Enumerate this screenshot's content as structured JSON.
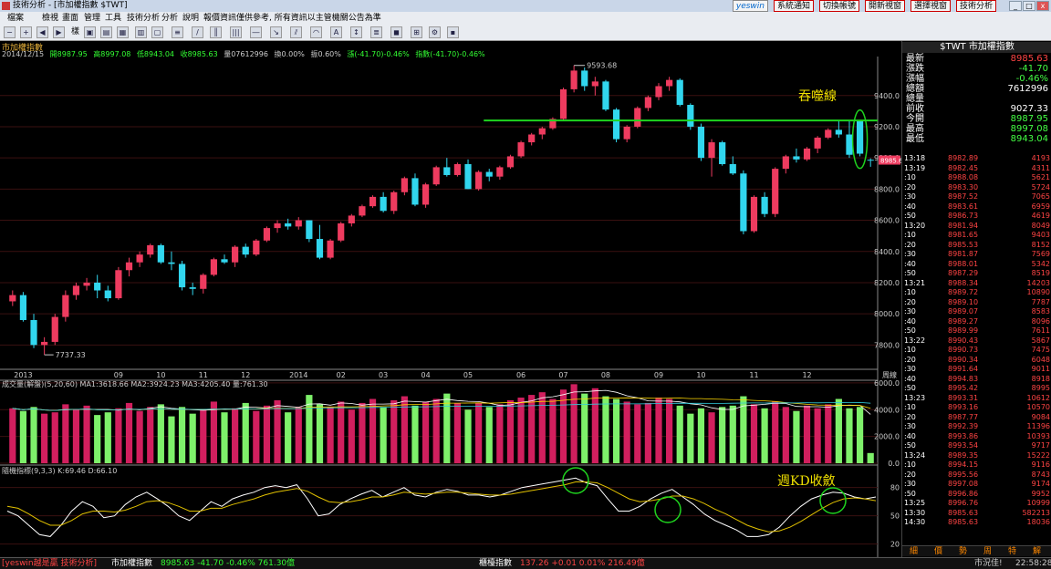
{
  "window": {
    "title": "技術分析 - [市加權指數 $TWT]",
    "min": "_",
    "max": "□",
    "close": "x"
  },
  "menu": [
    "檔案",
    "檢視",
    "畫面",
    "管理",
    "工具",
    "技術分析",
    "分析",
    "說明",
    "報價資訊僅供參考, 所有資訊以主管機關公告為準"
  ],
  "top_buttons": [
    "系統通知",
    "切換帳號",
    "開新視窗",
    "選擇視窗",
    "技術分析"
  ],
  "top_logo": "yeswin",
  "toolbar": {
    "template_label": "樣"
  },
  "chart": {
    "caption": "市加權指數",
    "info": {
      "date": "2014/12/15",
      "open": "開8987.95",
      "high": "高8997.08",
      "low": "低8943.04",
      "close": "收8985.63",
      "vol": "量07612996",
      "turnover": "換0.00%",
      "amp": "振0.60%",
      "chg": "漲(-41.70)-0.46%",
      "idx": "指數(-41.70)-0.46%"
    },
    "y_ticks": [
      "9400.0",
      "9200.0",
      "9000.0",
      "8800.0",
      "8600.0",
      "8400.0",
      "8200.0",
      "8000.0",
      "7800.0"
    ],
    "x_labels": [
      "2013",
      "09",
      "10",
      "11",
      "12",
      "2014",
      "02",
      "03",
      "04",
      "05",
      "06",
      "07",
      "08",
      "09",
      "10",
      "11",
      "12"
    ],
    "period_label": "周線",
    "high_label": "9593.68",
    "low_label": "7737.33",
    "last_price_tag": "8985.63",
    "annotation_line": "吞噬線",
    "annotation_kd": "週KD收斂",
    "colors": {
      "up": "#ee3b5f",
      "down": "#31d6ee",
      "line": "#1fd41f",
      "circle": "#1fd41f",
      "annot": "#f0e000"
    }
  },
  "volume": {
    "header": "成交量(解盤)(5,20,60) MA1:3618.66 MA2:3924.23 MA3:4205.40 量:761.30",
    "y_ticks": [
      "6000.0",
      "4000.0",
      "2000.0",
      "0.0"
    ]
  },
  "kd": {
    "header": "隨機指標(9,3,3) K:69.46 D:66.10",
    "y_ticks": [
      "80",
      "50",
      "20"
    ]
  },
  "chart_data": {
    "type": "candlestick",
    "period": "weekly",
    "ohlc": [
      [
        8080,
        8150,
        8050,
        8120
      ],
      [
        8120,
        8140,
        7950,
        7960
      ],
      [
        7960,
        8000,
        7780,
        7800
      ],
      [
        7800,
        7850,
        7737,
        7820
      ],
      [
        7820,
        8000,
        7800,
        7980
      ],
      [
        7980,
        8150,
        7950,
        8120
      ],
      [
        8120,
        8200,
        8090,
        8180
      ],
      [
        8180,
        8230,
        8150,
        8200
      ],
      [
        8200,
        8250,
        8100,
        8150
      ],
      [
        8150,
        8180,
        8080,
        8100
      ],
      [
        8100,
        8300,
        8090,
        8280
      ],
      [
        8280,
        8360,
        8240,
        8330
      ],
      [
        8330,
        8400,
        8300,
        8380
      ],
      [
        8380,
        8450,
        8360,
        8440
      ],
      [
        8440,
        8450,
        8320,
        8330
      ],
      [
        8330,
        8400,
        8280,
        8320
      ],
      [
        8320,
        8340,
        8150,
        8170
      ],
      [
        8170,
        8200,
        8120,
        8160
      ],
      [
        8160,
        8260,
        8130,
        8250
      ],
      [
        8250,
        8360,
        8240,
        8350
      ],
      [
        8350,
        8380,
        8320,
        8330
      ],
      [
        8330,
        8440,
        8300,
        8430
      ],
      [
        8430,
        8450,
        8360,
        8380
      ],
      [
        8380,
        8480,
        8370,
        8470
      ],
      [
        8470,
        8560,
        8460,
        8550
      ],
      [
        8550,
        8600,
        8520,
        8580
      ],
      [
        8580,
        8610,
        8540,
        8560
      ],
      [
        8560,
        8620,
        8540,
        8600
      ],
      [
        8600,
        8600,
        8460,
        8480
      ],
      [
        8480,
        8570,
        8350,
        8360
      ],
      [
        8360,
        8480,
        8350,
        8470
      ],
      [
        8470,
        8590,
        8460,
        8580
      ],
      [
        8580,
        8640,
        8560,
        8630
      ],
      [
        8630,
        8700,
        8620,
        8690
      ],
      [
        8690,
        8760,
        8680,
        8750
      ],
      [
        8750,
        8780,
        8650,
        8660
      ],
      [
        8660,
        8790,
        8640,
        8780
      ],
      [
        8780,
        8880,
        8760,
        8870
      ],
      [
        8870,
        8900,
        8690,
        8700
      ],
      [
        8700,
        8840,
        8680,
        8830
      ],
      [
        8830,
        8950,
        8820,
        8940
      ],
      [
        8940,
        9000,
        8880,
        8890
      ],
      [
        8890,
        8970,
        8880,
        8960
      ],
      [
        8960,
        8990,
        8800,
        8800
      ],
      [
        8800,
        8920,
        8790,
        8910
      ],
      [
        8910,
        8930,
        8850,
        8880
      ],
      [
        8880,
        8950,
        8860,
        8940
      ],
      [
        8940,
        9020,
        8930,
        9010
      ],
      [
        9010,
        9110,
        9000,
        9100
      ],
      [
        9100,
        9160,
        9080,
        9150
      ],
      [
        9150,
        9200,
        9120,
        9190
      ],
      [
        9190,
        9260,
        9180,
        9250
      ],
      [
        9250,
        9450,
        9240,
        9440
      ],
      [
        9440,
        9593,
        9420,
        9560
      ],
      [
        9560,
        9580,
        9430,
        9460
      ],
      [
        9460,
        9520,
        9400,
        9490
      ],
      [
        9490,
        9500,
        9300,
        9310
      ],
      [
        9310,
        9320,
        9100,
        9120
      ],
      [
        9120,
        9210,
        9100,
        9200
      ],
      [
        9200,
        9330,
        9190,
        9320
      ],
      [
        9320,
        9400,
        9300,
        9390
      ],
      [
        9390,
        9480,
        9370,
        9460
      ],
      [
        9460,
        9520,
        9430,
        9500
      ],
      [
        9500,
        9510,
        9330,
        9340
      ],
      [
        9340,
        9350,
        9180,
        9200
      ],
      [
        9200,
        9220,
        8980,
        9000
      ],
      [
        9000,
        9120,
        8880,
        9100
      ],
      [
        9100,
        9110,
        8950,
        8960
      ],
      [
        8960,
        9010,
        8890,
        8900
      ],
      [
        8900,
        8920,
        8510,
        8530
      ],
      [
        8530,
        8760,
        8520,
        8750
      ],
      [
        8750,
        8780,
        8620,
        8640
      ],
      [
        8640,
        8940,
        8620,
        8930
      ],
      [
        8930,
        9020,
        8900,
        9010
      ],
      [
        9010,
        9060,
        8970,
        8990
      ],
      [
        8990,
        9070,
        8980,
        9060
      ],
      [
        9060,
        9140,
        9030,
        9130
      ],
      [
        9130,
        9190,
        9120,
        9180
      ],
      [
        9180,
        9240,
        9130,
        9150
      ],
      [
        9150,
        9240,
        9000,
        9020
      ],
      [
        9240,
        9240,
        9010,
        9027
      ],
      [
        8988,
        8997,
        8943,
        8986
      ]
    ],
    "volume": [
      4100,
      3900,
      4200,
      3700,
      3800,
      4400,
      4000,
      4300,
      3600,
      3800,
      4100,
      4500,
      3900,
      4200,
      4400,
      3500,
      4200,
      3700,
      4000,
      4600,
      3800,
      4100,
      4500,
      3900,
      4300,
      4700,
      3800,
      4200,
      5100,
      4400,
      4200,
      4600,
      4000,
      4500,
      4800,
      4200,
      4700,
      5000,
      4300,
      4600,
      4800,
      5200,
      4500,
      4000,
      4500,
      4200,
      4400,
      4700,
      4900,
      5100,
      5300,
      4800,
      5500,
      5900,
      5200,
      5600,
      5000,
      4800,
      4600,
      4400,
      4500,
      4900,
      4800,
      4300,
      3700,
      4100,
      3800,
      4200,
      4300,
      5000,
      4400,
      4100,
      4600,
      4200,
      3900,
      4300,
      4100,
      4400,
      4800,
      4100,
      4200,
      761
    ],
    "kd_k": [
      55,
      50,
      40,
      30,
      28,
      40,
      55,
      65,
      60,
      48,
      50,
      62,
      70,
      75,
      68,
      60,
      50,
      45,
      55,
      65,
      60,
      68,
      72,
      75,
      80,
      82,
      80,
      83,
      68,
      50,
      52,
      62,
      68,
      73,
      77,
      70,
      75,
      80,
      72,
      70,
      75,
      78,
      76,
      72,
      72,
      70,
      72,
      76,
      80,
      82,
      84,
      86,
      88,
      90,
      85,
      82,
      68,
      55,
      55,
      60,
      68,
      74,
      78,
      70,
      62,
      52,
      45,
      40,
      35,
      28,
      28,
      30,
      38,
      50,
      60,
      68,
      72,
      75,
      74,
      70,
      68,
      70
    ],
    "kd_d": [
      60,
      58,
      52,
      45,
      40,
      40,
      45,
      52,
      55,
      55,
      54,
      56,
      60,
      65,
      66,
      64,
      60,
      55,
      55,
      58,
      58,
      62,
      65,
      68,
      72,
      75,
      77,
      79,
      76,
      70,
      65,
      64,
      65,
      67,
      70,
      70,
      72,
      75,
      74,
      73,
      74,
      75,
      75,
      74,
      73,
      72,
      72,
      73,
      75,
      77,
      79,
      81,
      83,
      86,
      86,
      85,
      80,
      74,
      68,
      65,
      66,
      68,
      71,
      71,
      68,
      63,
      57,
      52,
      46,
      40,
      36,
      33,
      34,
      38,
      44,
      51,
      58,
      64,
      68,
      69,
      68,
      66
    ],
    "y_range": [
      7650,
      9650
    ],
    "volume_range": [
      0,
      6400
    ],
    "kd_range": [
      10,
      100
    ]
  },
  "right_panel": {
    "title": "$TWT 市加權指數",
    "quotes": [
      {
        "label": "最新",
        "value": "8985.63",
        "color": "#ff4444"
      },
      {
        "label": "漲跌",
        "value": "-41.70",
        "color": "#44ff44"
      },
      {
        "label": "漲幅",
        "value": "-0.46%",
        "color": "#44ff44"
      },
      {
        "label": "總額",
        "value": "7612996",
        "color": "#ffffff"
      },
      {
        "label": "總量",
        "value": "",
        "color": "#ffffff"
      },
      {
        "label": "前收",
        "value": "9027.33",
        "color": "#ffffff"
      },
      {
        "label": "今開",
        "value": "8987.95",
        "color": "#44ff44"
      },
      {
        "label": "最高",
        "value": "8997.08",
        "color": "#44ff44"
      },
      {
        "label": "最低",
        "value": "8943.04",
        "color": "#44ff44"
      }
    ],
    "ticks": [
      {
        "t": "13:18",
        "p": "8982.89",
        "v": "4193"
      },
      {
        "t": "13:19",
        "p": "8982.45",
        "v": "4311"
      },
      {
        "t": ":10",
        "p": "8988.08",
        "v": "5621"
      },
      {
        "t": ":20",
        "p": "8983.30",
        "v": "5724"
      },
      {
        "t": ":30",
        "p": "8987.52",
        "v": "7065"
      },
      {
        "t": ":40",
        "p": "8983.61",
        "v": "6959"
      },
      {
        "t": ":50",
        "p": "8986.73",
        "v": "4619"
      },
      {
        "t": "13:20",
        "p": "8981.94",
        "v": "8049"
      },
      {
        "t": ":10",
        "p": "8981.65",
        "v": "9403"
      },
      {
        "t": ":20",
        "p": "8985.53",
        "v": "8152"
      },
      {
        "t": ":30",
        "p": "8981.87",
        "v": "7569"
      },
      {
        "t": ":40",
        "p": "8988.01",
        "v": "5342"
      },
      {
        "t": ":50",
        "p": "8987.29",
        "v": "8519"
      },
      {
        "t": "13:21",
        "p": "8988.34",
        "v": "14203"
      },
      {
        "t": ":10",
        "p": "8989.72",
        "v": "10890"
      },
      {
        "t": ":20",
        "p": "8989.10",
        "v": "7787"
      },
      {
        "t": ":30",
        "p": "8989.07",
        "v": "8583"
      },
      {
        "t": ":40",
        "p": "8989.27",
        "v": "8096"
      },
      {
        "t": ":50",
        "p": "8989.99",
        "v": "7611"
      },
      {
        "t": "13:22",
        "p": "8990.43",
        "v": "5867"
      },
      {
        "t": ":10",
        "p": "8990.73",
        "v": "7475"
      },
      {
        "t": ":20",
        "p": "8990.34",
        "v": "6048"
      },
      {
        "t": ":30",
        "p": "8991.64",
        "v": "9011"
      },
      {
        "t": ":40",
        "p": "8994.83",
        "v": "8918"
      },
      {
        "t": ":50",
        "p": "8995.42",
        "v": "8995"
      },
      {
        "t": "13:23",
        "p": "8993.31",
        "v": "10612"
      },
      {
        "t": ":10",
        "p": "8993.16",
        "v": "10570"
      },
      {
        "t": ":20",
        "p": "8987.77",
        "v": "9084"
      },
      {
        "t": ":30",
        "p": "8992.39",
        "v": "11396"
      },
      {
        "t": ":40",
        "p": "8993.86",
        "v": "10393"
      },
      {
        "t": ":50",
        "p": "8993.54",
        "v": "9717"
      },
      {
        "t": "13:24",
        "p": "8989.35",
        "v": "15222"
      },
      {
        "t": ":10",
        "p": "8994.15",
        "v": "9116"
      },
      {
        "t": ":20",
        "p": "8995.56",
        "v": "8743"
      },
      {
        "t": ":30",
        "p": "8997.08",
        "v": "9174"
      },
      {
        "t": ":50",
        "p": "8996.86",
        "v": "9952"
      },
      {
        "t": "13:25",
        "p": "8996.76",
        "v": "10999"
      },
      {
        "t": "13:30",
        "p": "8985.63",
        "v": "582213"
      },
      {
        "t": "14:30",
        "p": "8985.63",
        "v": "18036"
      }
    ],
    "tabs": [
      "細",
      "價",
      "勢",
      "周",
      "特",
      "解"
    ]
  },
  "bottom": {
    "brand": "[yeswin越是贏 技術分析]",
    "index1_name": "市加權指數",
    "index1_vals": "8985.63 -41.70 -0.46% 761.30億",
    "index2_name": "櫃檯指數",
    "index2_vals": "137.26 +0.01 0.01% 216.49億",
    "status": "市況佳!",
    "clock": "22:58:28"
  }
}
